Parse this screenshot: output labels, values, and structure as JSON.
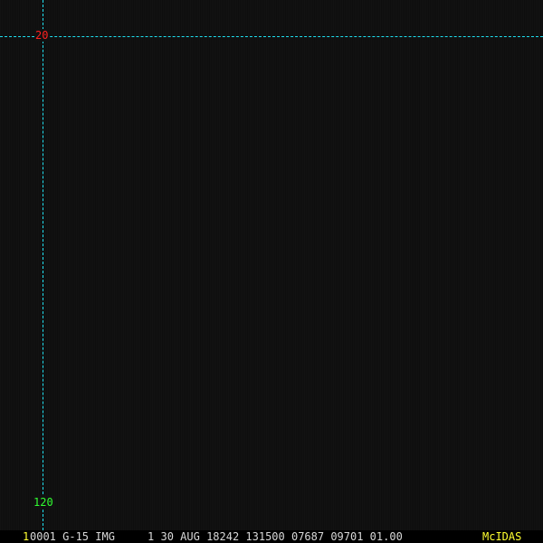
{
  "overlay": {
    "latitude_label": "20",
    "longitude_label": "120"
  },
  "status_bar": {
    "frame_number": "1",
    "info": "0001 G-15 IMG     1 30 AUG 18242 131500 07687 09701 01.00",
    "brand": "McIDAS"
  },
  "colors": {
    "grid": "#1ee0f0",
    "latitude_label": "#ff2020",
    "longitude_label": "#30ff30",
    "brand": "#ffff30"
  }
}
